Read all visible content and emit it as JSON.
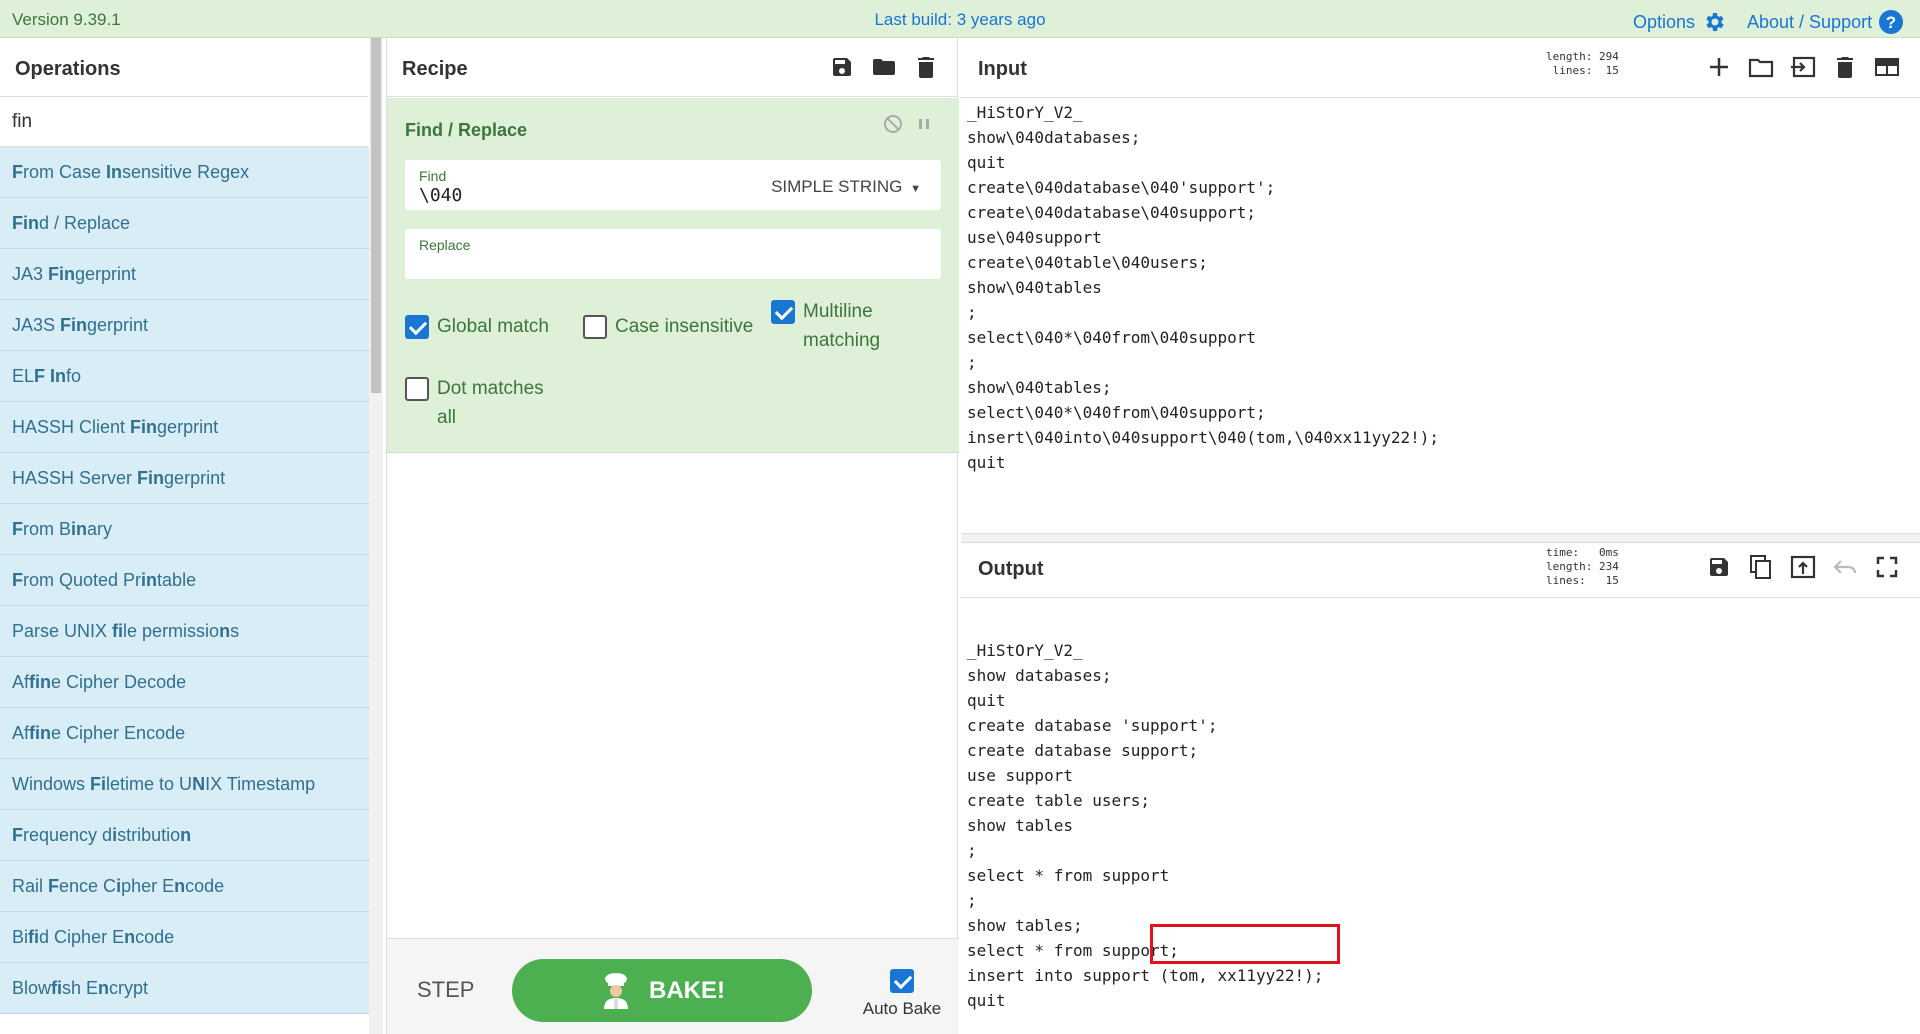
{
  "banner": {
    "version": "Version 9.39.1",
    "build": "Last build: 3 years ago",
    "options": "Options",
    "about": "About / Support",
    "icons": [
      "gear-icon",
      "help-icon"
    ]
  },
  "operations": {
    "title": "Operations",
    "search_value": "fin",
    "items": [
      {
        "pre": "",
        "b1": "F",
        "mid": "rom Case ",
        "b2": "In",
        "post": "sensitive Regex"
      },
      {
        "pre": "",
        "b1": "Fin",
        "mid": "d / Replace",
        "b2": "",
        "post": ""
      },
      {
        "pre": "JA3 ",
        "b1": "Fin",
        "mid": "gerprint",
        "b2": "",
        "post": ""
      },
      {
        "pre": "JA3S ",
        "b1": "Fin",
        "mid": "gerprint",
        "b2": "",
        "post": ""
      },
      {
        "pre": "EL",
        "b1": "F",
        "mid": " ",
        "b2": "In",
        "post": "fo"
      },
      {
        "pre": "HASSH Client ",
        "b1": "Fin",
        "mid": "gerprint",
        "b2": "",
        "post": ""
      },
      {
        "pre": "HASSH Server ",
        "b1": "Fin",
        "mid": "gerprint",
        "b2": "",
        "post": ""
      },
      {
        "pre": "",
        "b1": "F",
        "mid": "rom B",
        "b2": "in",
        "post": "ary"
      },
      {
        "pre": "",
        "b1": "F",
        "mid": "rom Quoted Pr",
        "b2": "in",
        "post": "table"
      },
      {
        "pre": "Parse UNIX ",
        "b1": "fi",
        "mid": "le permissio",
        "b2": "n",
        "post": "s"
      },
      {
        "pre": "Af",
        "b1": "fin",
        "mid": "e Cipher Decode",
        "b2": "",
        "post": ""
      },
      {
        "pre": "Af",
        "b1": "fin",
        "mid": "e Cipher Encode",
        "b2": "",
        "post": ""
      },
      {
        "pre": "Windows ",
        "b1": "Fi",
        "mid": "letime to U",
        "b2": "N",
        "post": "IX Timestamp"
      },
      {
        "pre": "",
        "b1": "F",
        "mid": "requency d",
        "b2": "i",
        "post": "stributio",
        "b3": "n"
      },
      {
        "pre": "Rail ",
        "b1": "F",
        "mid": "ence C",
        "b2": "i",
        "post": "pher E",
        "b3": "n",
        "post2": "code"
      },
      {
        "pre": "Bi",
        "b1": "f",
        "mid": "",
        "b2": "i",
        "post": "d Cipher E",
        "b3": "n",
        "post2": "code"
      },
      {
        "pre": "Blow",
        "b1": "fi",
        "mid": "sh E",
        "b2": "n",
        "post": "crypt"
      }
    ]
  },
  "recipe": {
    "title": "Recipe",
    "toolbar_icons": [
      "save-icon",
      "folder-icon",
      "trash-icon"
    ],
    "operation": {
      "name": "Find / Replace",
      "find_label": "Find",
      "find_value": "\\040",
      "find_type": "SIMPLE STRING",
      "replace_label": "Replace",
      "replace_value": "",
      "options": {
        "global": "Global match",
        "case": "Case insensitive",
        "multiline": "Multiline matching",
        "dotall": "Dot matches all"
      },
      "checked": {
        "global": true,
        "case": false,
        "multiline": true,
        "dotall": false
      }
    },
    "step_label": "STEP",
    "bake_label": "BAKE!",
    "auto_bake_label": "Auto Bake",
    "auto_bake": true
  },
  "input": {
    "title": "Input",
    "stats": "length: 294\nlines:  15",
    "icons": [
      "plus-icon",
      "folder-icon",
      "import-icon",
      "trash-icon",
      "layout-icon"
    ],
    "text": "_HiStOrY_V2_\nshow\\040databases;\nquit\ncreate\\040database\\040'support';\ncreate\\040database\\040support;\nuse\\040support\ncreate\\040table\\040users;\nshow\\040tables\n;\nselect\\040*\\040from\\040support\n;\nshow\\040tables;\nselect\\040*\\040from\\040support;\ninsert\\040into\\040support\\040(tom,\\040xx11yy22!);\nquit"
  },
  "output": {
    "title": "Output",
    "stats": "time:   0ms\nlength: 234\nlines:   15",
    "icons": [
      "save-icon",
      "copy-icon",
      "replace-input-icon",
      "undo-icon",
      "maximize-icon"
    ],
    "text": "_HiStOrY_V2_\nshow databases;\nquit\ncreate database 'support';\ncreate database support;\nuse support\ncreate table users;\nshow tables\n;\nselect * from support\n;\nshow tables;\nselect * from support;\ninsert into support (tom, xx11yy22!);\nquit",
    "highlight_color": "#e0141e"
  }
}
